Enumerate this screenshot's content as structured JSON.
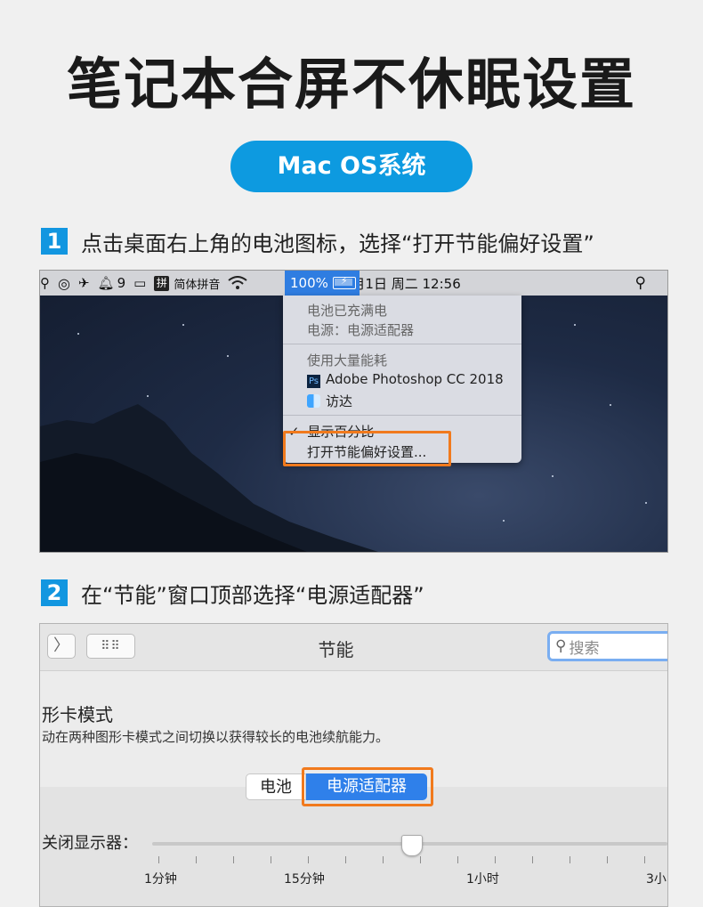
{
  "title": "笔记本合屏不休眠设置",
  "os_label": "Mac OS系统",
  "step1": {
    "number": "1",
    "text": "点击桌面右上角的电池图标，选择“打开节能偏好设置”",
    "menubar": {
      "notification_count": "9",
      "input_method": "简体拼音",
      "battery_percent": "100%",
      "datetime": "12月1日 周二  12:56"
    },
    "menu": {
      "status_line1": "电池已充满电",
      "status_line2": "电源：电源适配器",
      "section_heading": "使用大量能耗",
      "app1": "Adobe Photoshop CC 2018",
      "app2": "访达",
      "show_percent": "显示百分比",
      "open_prefs": "打开节能偏好设置..."
    }
  },
  "step2": {
    "number": "2",
    "text": "在“节能”窗口顶部选择“电源适配器”",
    "window": {
      "title": "节能",
      "search_placeholder": "搜索",
      "section_heading": "形卡模式",
      "section_desc": "动在两种图形卡模式之间切换以获得较长的电池续航能力。",
      "tab_battery": "电池",
      "tab_power_adapter": "电源适配器",
      "slider_label": "关闭显示器：",
      "tick_labels": [
        "1分钟",
        "15分钟",
        "1小时",
        "3小"
      ]
    }
  },
  "colors": {
    "accent_blue": "#0d9ae0",
    "highlight_orange": "#f17a1d",
    "mac_selection": "#2f7de1"
  }
}
